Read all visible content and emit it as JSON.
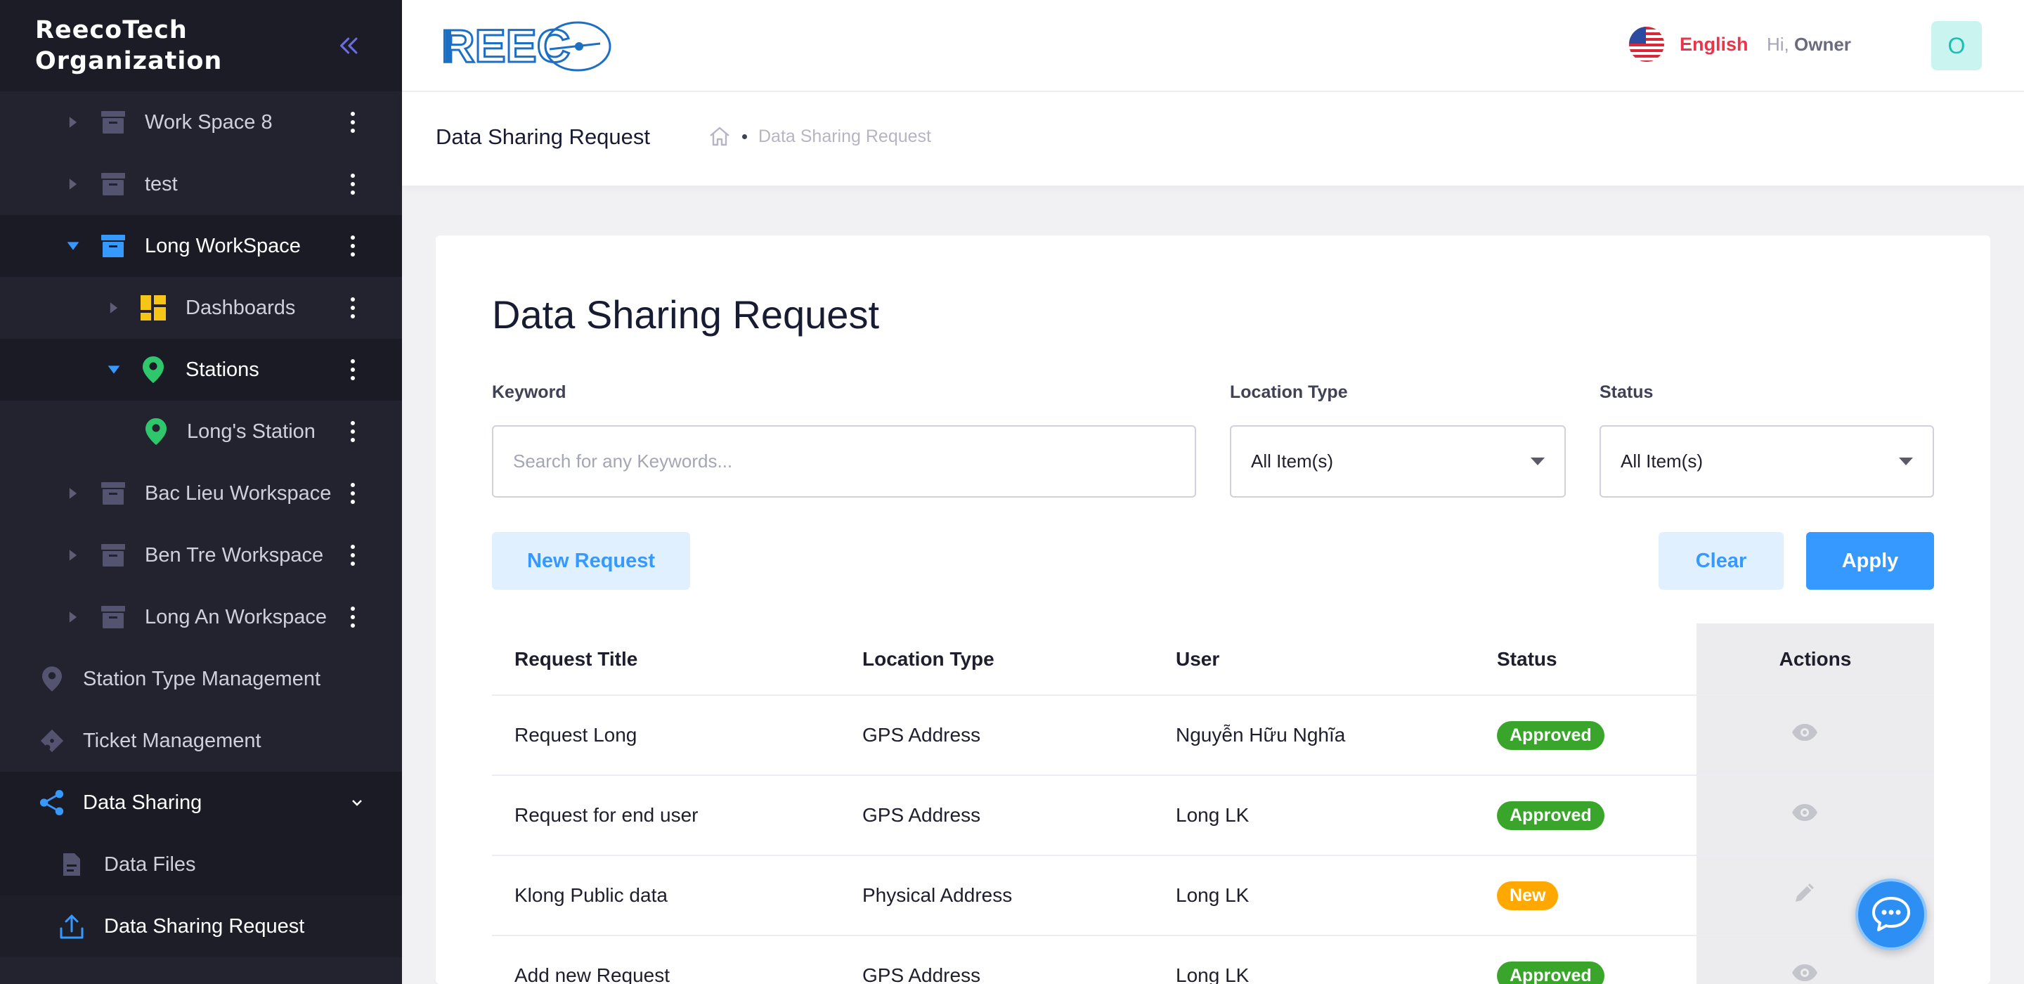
{
  "sidebar": {
    "org_name": "ReecoTech Organization",
    "items": [
      {
        "label": "Work Space 8"
      },
      {
        "label": "test"
      },
      {
        "label": "Long WorkSpace"
      },
      {
        "label": "Dashboards"
      },
      {
        "label": "Stations"
      },
      {
        "label": "Long's Station"
      },
      {
        "label": "Bac Lieu Workspace"
      },
      {
        "label": "Ben Tre Workspace"
      },
      {
        "label": "Long An Workspace"
      },
      {
        "label": "Station Type Management"
      },
      {
        "label": "Ticket Management"
      },
      {
        "label": "Data Sharing"
      },
      {
        "label": "Data Files"
      },
      {
        "label": "Data Sharing Request"
      }
    ]
  },
  "header": {
    "logo_text": "REEC",
    "language": "English",
    "greeting": "Hi,",
    "user_name": "Owner",
    "avatar_letter": "O"
  },
  "subheader": {
    "title": "Data Sharing Request",
    "breadcrumb": "Data Sharing Request"
  },
  "page": {
    "title": "Data Sharing Request",
    "filters": {
      "keyword_label": "Keyword",
      "keyword_placeholder": "Search for any Keywords...",
      "location_type_label": "Location Type",
      "location_type_value": "All Item(s)",
      "status_label": "Status",
      "status_value": "All Item(s)"
    },
    "buttons": {
      "new_request": "New Request",
      "clear": "Clear",
      "apply": "Apply"
    }
  },
  "table": {
    "columns": [
      "Request Title",
      "Location Type",
      "User",
      "Status",
      "Actions"
    ],
    "rows": [
      {
        "title": "Request Long",
        "location_type": "GPS Address",
        "user": "Nguyễn Hữu Nghĩa",
        "status": "Approved",
        "action": "view"
      },
      {
        "title": "Request for end user",
        "location_type": "GPS Address",
        "user": "Long LK",
        "status": "Approved",
        "action": "view"
      },
      {
        "title": "Klong Public data",
        "location_type": "Physical Address",
        "user": "Long LK",
        "status": "New",
        "action": "edit"
      },
      {
        "title": "Add new Request",
        "location_type": "GPS Address",
        "user": "Long LK",
        "status": "Approved",
        "action": "view"
      }
    ]
  },
  "colors": {
    "sidebar_bg": "#23232f",
    "primary": "#3699ff",
    "approved": "#3aa52b",
    "new": "#ffa800",
    "language": "#e8354b",
    "station_pin": "#2fc76b",
    "dashboard": "#f5c518"
  },
  "icons": [
    "chevron-double-left-icon",
    "folder-box-icon",
    "dashboard-grid-icon",
    "location-pin-icon",
    "ticket-icon",
    "share-icon",
    "document-icon",
    "upload-icon",
    "home-icon",
    "us-flag-icon",
    "eye-icon",
    "pencil-icon",
    "chat-icon"
  ]
}
